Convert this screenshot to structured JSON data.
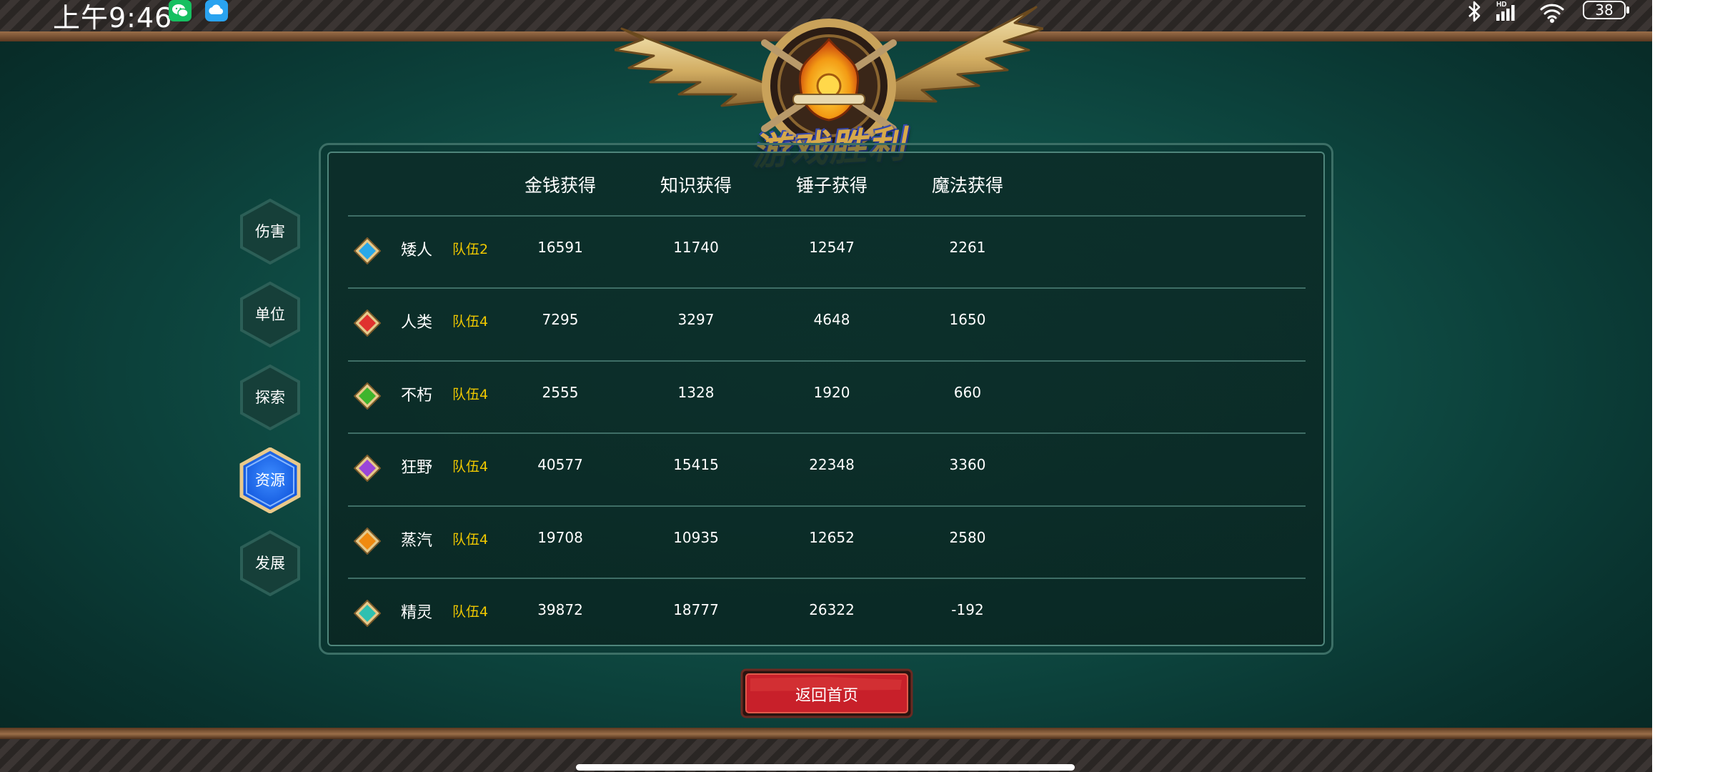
{
  "status_bar": {
    "time": "上午9:46",
    "left_icons": [
      "wechat-icon",
      "cloud-icon"
    ],
    "right_icons": [
      "bluetooth-icon",
      "signal-hd-icon",
      "wifi-icon"
    ],
    "battery": "38"
  },
  "banner": {
    "title": "游戏胜利"
  },
  "side_tabs": [
    {
      "label": "伤害",
      "active": false
    },
    {
      "label": "单位",
      "active": false
    },
    {
      "label": "探索",
      "active": false
    },
    {
      "label": "资源",
      "active": true
    },
    {
      "label": "发展",
      "active": false
    }
  ],
  "table": {
    "headers": [
      "金钱获得",
      "知识获得",
      "锤子获得",
      "魔法获得"
    ],
    "rows": [
      {
        "gem_color": "#29a8e8",
        "race": "矮人",
        "team": "队伍2",
        "values": [
          "16591",
          "11740",
          "12547",
          "2261"
        ]
      },
      {
        "gem_color": "#e0322f",
        "race": "人类",
        "team": "队伍4",
        "values": [
          "7295",
          "3297",
          "4648",
          "1650"
        ]
      },
      {
        "gem_color": "#3fb52d",
        "race": "不朽",
        "team": "队伍4",
        "values": [
          "2555",
          "1328",
          "1920",
          "660"
        ]
      },
      {
        "gem_color": "#9a45d8",
        "race": "狂野",
        "team": "队伍4",
        "values": [
          "40577",
          "15415",
          "22348",
          "3360"
        ]
      },
      {
        "gem_color": "#f08a10",
        "race": "蒸汽",
        "team": "队伍4",
        "values": [
          "19708",
          "10935",
          "12652",
          "2580"
        ]
      },
      {
        "gem_color": "#2fc0b0",
        "race": "精灵",
        "team": "队伍4",
        "values": [
          "39872",
          "18777",
          "26322",
          "-192"
        ]
      }
    ]
  },
  "return_button": {
    "label": "返回首页"
  },
  "colors": {
    "background": "#0f4e46",
    "team_text": "#f0c800",
    "active_tab": "#1565f0",
    "button": "#c8202a"
  }
}
